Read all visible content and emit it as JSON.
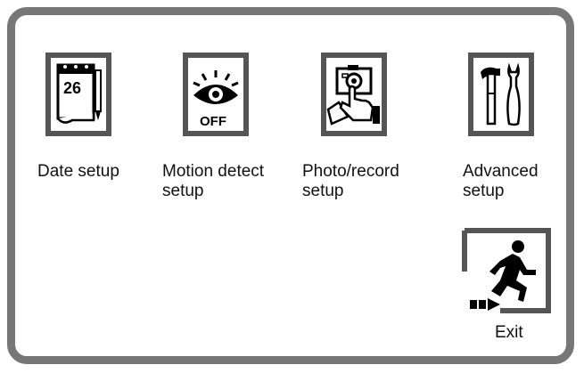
{
  "menu": {
    "items": [
      {
        "id": "date",
        "line1": "Date setup",
        "line2": "",
        "icon": "calendar-icon"
      },
      {
        "id": "motion",
        "line1": "Motion detect",
        "line2": "setup",
        "icon": "motion-eye-off-icon",
        "icon_text": "OFF"
      },
      {
        "id": "photo",
        "line1": "Photo/record",
        "line2": "setup",
        "icon": "camera-hand-icon"
      },
      {
        "id": "advanced",
        "line1": "Advanced",
        "line2": "setup",
        "icon": "tools-icon"
      }
    ],
    "calendar_day": "26",
    "exit_label": "Exit",
    "exit_icon": "running-man-exit-icon"
  },
  "colors": {
    "frame": "#777777",
    "icon_border": "#555555",
    "text": "#111111"
  }
}
